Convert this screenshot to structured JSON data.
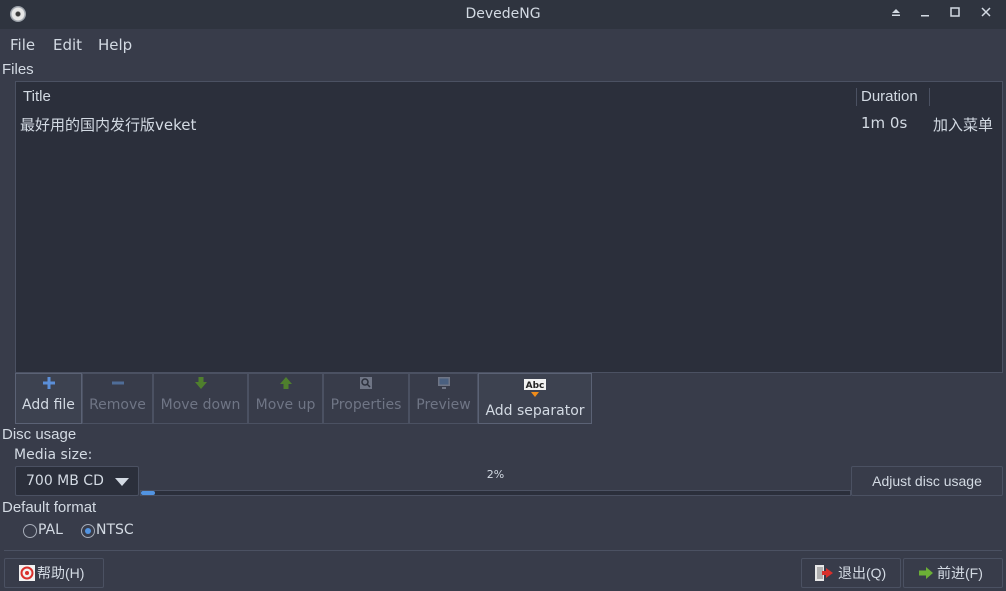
{
  "window": {
    "title": "DevedeNG"
  },
  "menubar": {
    "items": [
      "File",
      "Edit",
      "Help"
    ]
  },
  "files": {
    "section_label": "Files",
    "columns": {
      "title": "Title",
      "duration": "Duration"
    },
    "rows": [
      {
        "title": "最好用的国内发行版veket",
        "duration": "1m 0s",
        "extra": "加入菜单"
      }
    ]
  },
  "toolbar": {
    "add_file": "Add file",
    "remove": "Remove",
    "move_down": "Move down",
    "move_up": "Move up",
    "properties": "Properties",
    "preview": "Preview",
    "add_separator": "Add separator"
  },
  "disc_usage": {
    "section_label": "Disc usage",
    "media_size_label": "Media size:",
    "media_size_value": "700 MB CD",
    "progress_text": "2%",
    "progress_fraction": 0.02,
    "adjust_button": "Adjust disc usage"
  },
  "default_format": {
    "section_label": "Default format",
    "options": [
      {
        "label": "PAL",
        "checked": false
      },
      {
        "label": "NTSC",
        "checked": true
      }
    ]
  },
  "footer": {
    "help_button": "帮助(H)",
    "quit_button": "退出(Q)",
    "forward_button": "前进(F)"
  },
  "colors": {
    "background": "#383c4a",
    "list_background": "#2b2f3b",
    "accent": "#5294e2",
    "icon_blue": "#5b8fd9",
    "icon_green": "#6cb036"
  }
}
